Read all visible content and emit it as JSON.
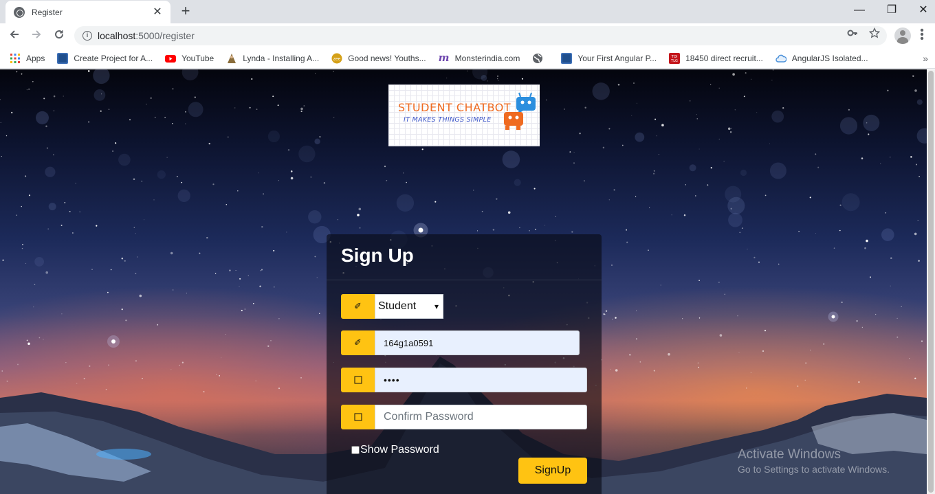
{
  "browser": {
    "tab_title": "Register",
    "tab_close": "✕",
    "new_tab": "+",
    "window_controls": {
      "minimize": "—",
      "restore": "❐",
      "close": "✕"
    },
    "url_host": "localhost",
    "url_rest": ":5000/register",
    "key_icon": "key-icon",
    "star_icon": "star-icon"
  },
  "bookmarks": [
    {
      "label": "Apps",
      "icon": "apps-grid-icon",
      "color": "#4285f4"
    },
    {
      "label": "Create Project for A...",
      "icon": "project-icon",
      "color": "#1f4e8c"
    },
    {
      "label": "YouTube",
      "icon": "youtube-icon",
      "color": "#ff0000"
    },
    {
      "label": "Lynda - Installing A...",
      "icon": "lynda-icon",
      "color": "#8a6d3b"
    },
    {
      "label": "Good news! Youths...",
      "icon": "news-icon",
      "color": "#d4a017"
    },
    {
      "label": "Monsterindia.com",
      "icon": "monster-icon",
      "color": "#6e46ae"
    },
    {
      "label": "",
      "icon": "globe-icon",
      "color": "#5f6368"
    },
    {
      "label": "Your First Angular P...",
      "icon": "angular-project-icon",
      "color": "#1f4e8c"
    },
    {
      "label": "18450 direct recruit...",
      "icon": "toi-icon",
      "color": "#c4161c"
    },
    {
      "label": "AngularJS Isolated...",
      "icon": "cloud-icon",
      "color": "#4a90d9"
    }
  ],
  "logo": {
    "line1": "STUDENT CHATBOT",
    "line2": "IT MAKES THINGS SIMPLE"
  },
  "form": {
    "title": "Sign Up",
    "role_icon": "✐",
    "role_selected": "Student",
    "role_caret": "▾",
    "id_icon": "✐",
    "id_value": "164g1a0591",
    "password_icon": "🔑",
    "password_value": "••••",
    "confirm_icon": "🔑",
    "confirm_placeholder": "Confirm Password",
    "show_password_label": "Show Password",
    "submit_label": "SignUp"
  },
  "watermark": {
    "line1": "Activate Windows",
    "line2": "Go to Settings to activate Windows."
  }
}
